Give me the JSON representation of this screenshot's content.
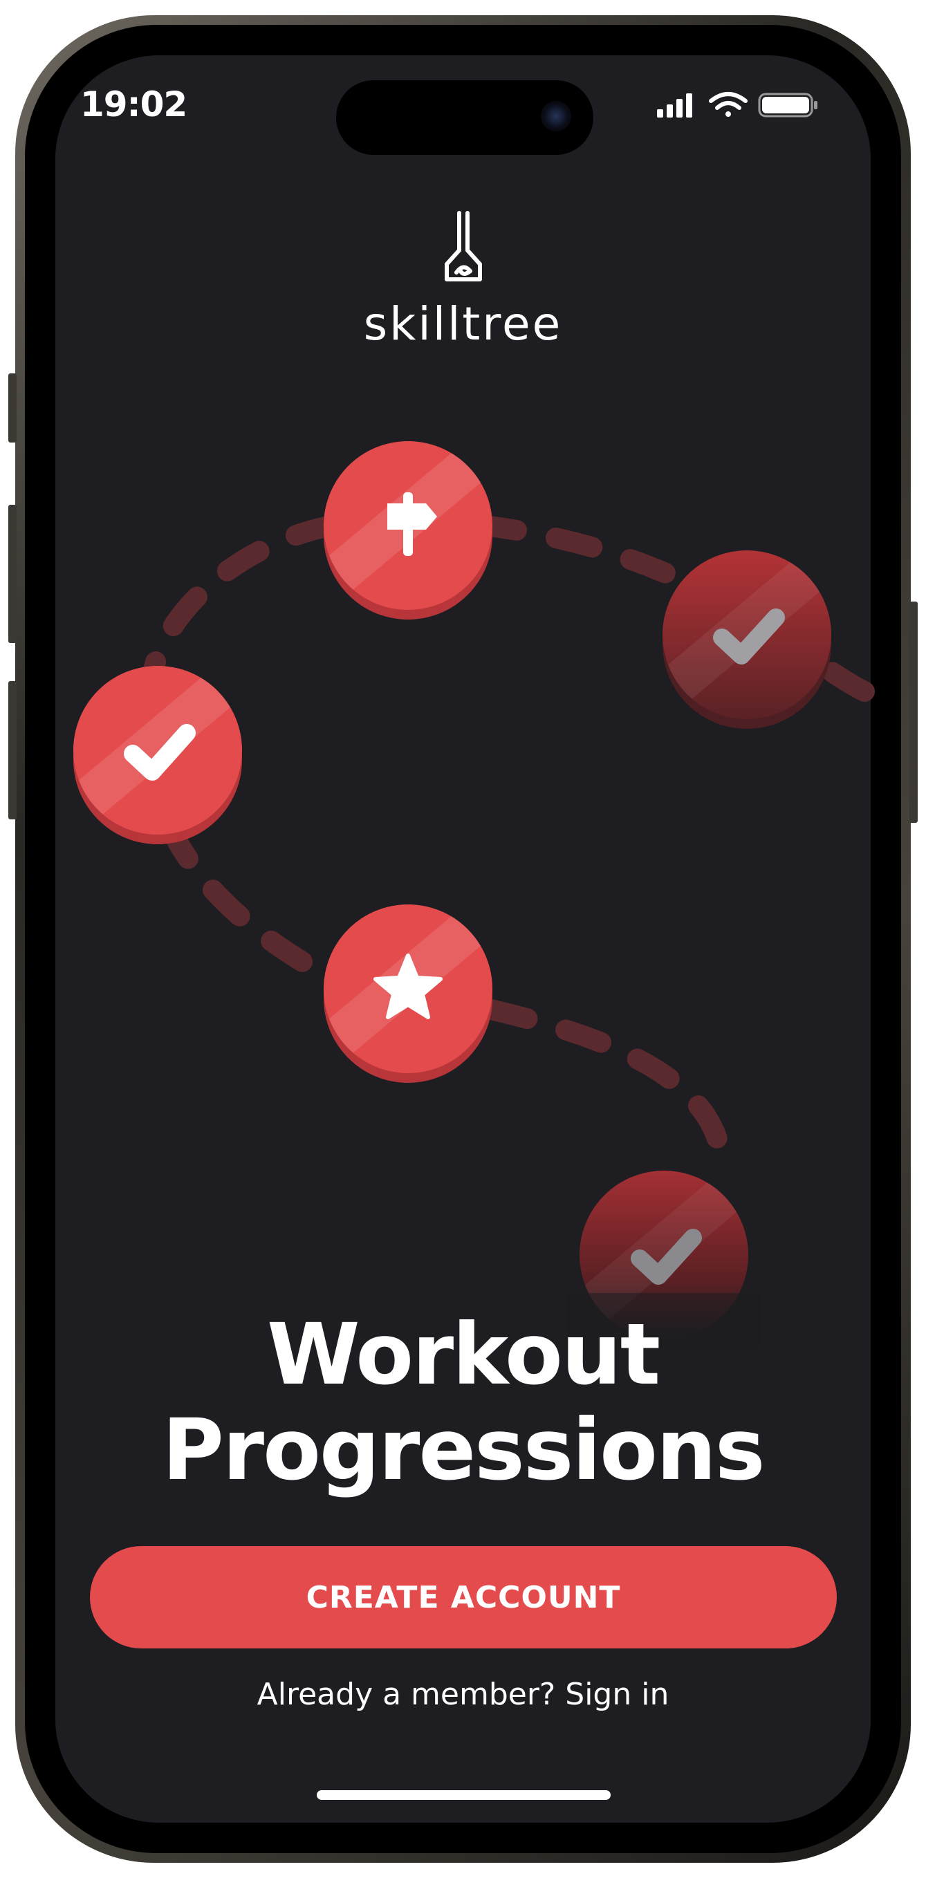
{
  "status_bar": {
    "time": "19:02"
  },
  "brand": {
    "name": "skilltree"
  },
  "hero": {
    "nodes": [
      {
        "icon": "signpost-icon",
        "state": "active"
      },
      {
        "icon": "check-icon",
        "state": "done"
      },
      {
        "icon": "check-icon",
        "state": "faded"
      },
      {
        "icon": "star-icon",
        "state": "active"
      },
      {
        "icon": "check-icon",
        "state": "faded"
      }
    ]
  },
  "headline": {
    "line1": "Workout",
    "line2": "Progressions"
  },
  "actions": {
    "create_account": "CREATE ACCOUNT",
    "sign_in": "Already a member? Sign in"
  },
  "colors": {
    "accent": "#e44b4d",
    "background": "#1e1d21",
    "text": "#ffffff"
  }
}
